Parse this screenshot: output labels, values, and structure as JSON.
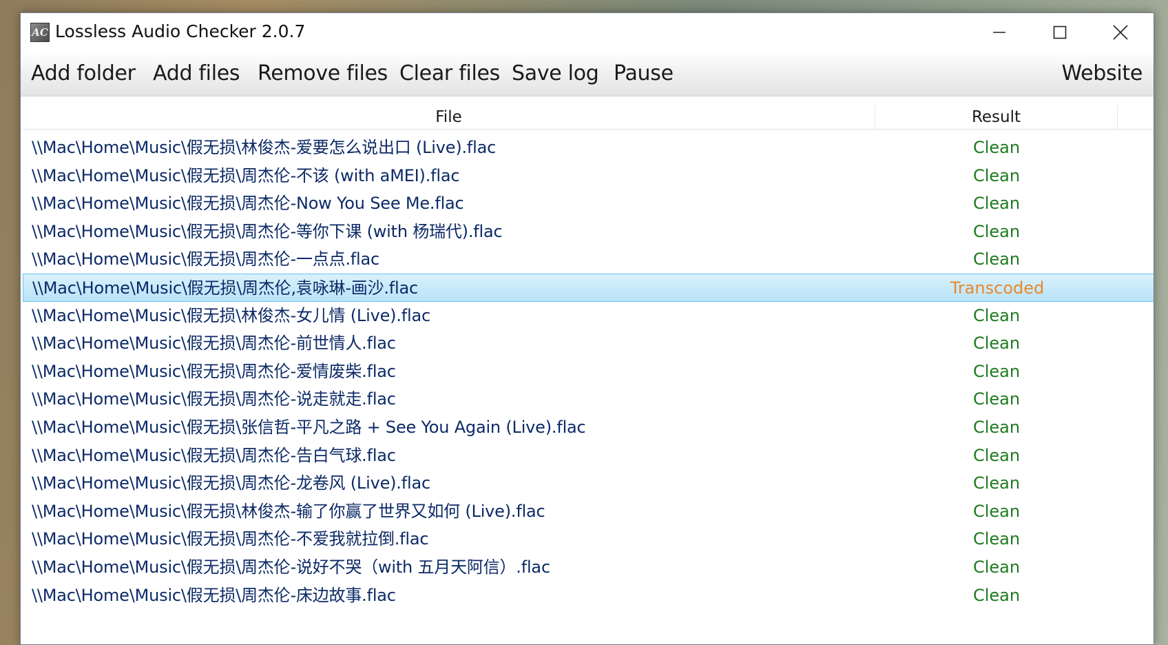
{
  "window": {
    "title": "Lossless Audio Checker 2.0.7",
    "icon_label": "AC"
  },
  "menu": {
    "add_folder": "Add folder",
    "add_files": "Add files",
    "remove_files": "Remove files",
    "clear_files": "Clear files",
    "save_log": "Save log",
    "pause": "Pause",
    "website": "Website"
  },
  "table": {
    "columns": {
      "file": "File",
      "result": "Result"
    },
    "selected_index": 5,
    "colors": {
      "clean": "#1f7a1f",
      "transcoded": "#e8892a",
      "path": "#0c2a66",
      "selection": "#b9e3f8"
    },
    "rows": [
      {
        "file": "\\\\Mac\\Home\\Music\\假无损\\林俊杰-爱要怎么说出口 (Live).flac",
        "result": "Clean"
      },
      {
        "file": "\\\\Mac\\Home\\Music\\假无损\\周杰伦-不该 (with aMEI).flac",
        "result": "Clean"
      },
      {
        "file": "\\\\Mac\\Home\\Music\\假无损\\周杰伦-Now You See Me.flac",
        "result": "Clean"
      },
      {
        "file": "\\\\Mac\\Home\\Music\\假无损\\周杰伦-等你下课 (with 杨瑞代).flac",
        "result": "Clean"
      },
      {
        "file": "\\\\Mac\\Home\\Music\\假无损\\周杰伦-一点点.flac",
        "result": "Clean"
      },
      {
        "file": "\\\\Mac\\Home\\Music\\假无损\\周杰伦,袁咏琳-画沙.flac",
        "result": "Transcoded"
      },
      {
        "file": "\\\\Mac\\Home\\Music\\假无损\\林俊杰-女儿情 (Live).flac",
        "result": "Clean"
      },
      {
        "file": "\\\\Mac\\Home\\Music\\假无损\\周杰伦-前世情人.flac",
        "result": "Clean"
      },
      {
        "file": "\\\\Mac\\Home\\Music\\假无损\\周杰伦-爱情废柴.flac",
        "result": "Clean"
      },
      {
        "file": "\\\\Mac\\Home\\Music\\假无损\\周杰伦-说走就走.flac",
        "result": "Clean"
      },
      {
        "file": "\\\\Mac\\Home\\Music\\假无损\\张信哲-平凡之路 + See You Again (Live).flac",
        "result": "Clean"
      },
      {
        "file": "\\\\Mac\\Home\\Music\\假无损\\周杰伦-告白气球.flac",
        "result": "Clean"
      },
      {
        "file": "\\\\Mac\\Home\\Music\\假无损\\周杰伦-龙卷风 (Live).flac",
        "result": "Clean"
      },
      {
        "file": "\\\\Mac\\Home\\Music\\假无损\\林俊杰-输了你赢了世界又如何 (Live).flac",
        "result": "Clean"
      },
      {
        "file": "\\\\Mac\\Home\\Music\\假无损\\周杰伦-不爱我就拉倒.flac",
        "result": "Clean"
      },
      {
        "file": "\\\\Mac\\Home\\Music\\假无损\\周杰伦-说好不哭（with 五月天阿信）.flac",
        "result": "Clean"
      },
      {
        "file": "\\\\Mac\\Home\\Music\\假无损\\周杰伦-床边故事.flac",
        "result": "Clean"
      }
    ]
  }
}
